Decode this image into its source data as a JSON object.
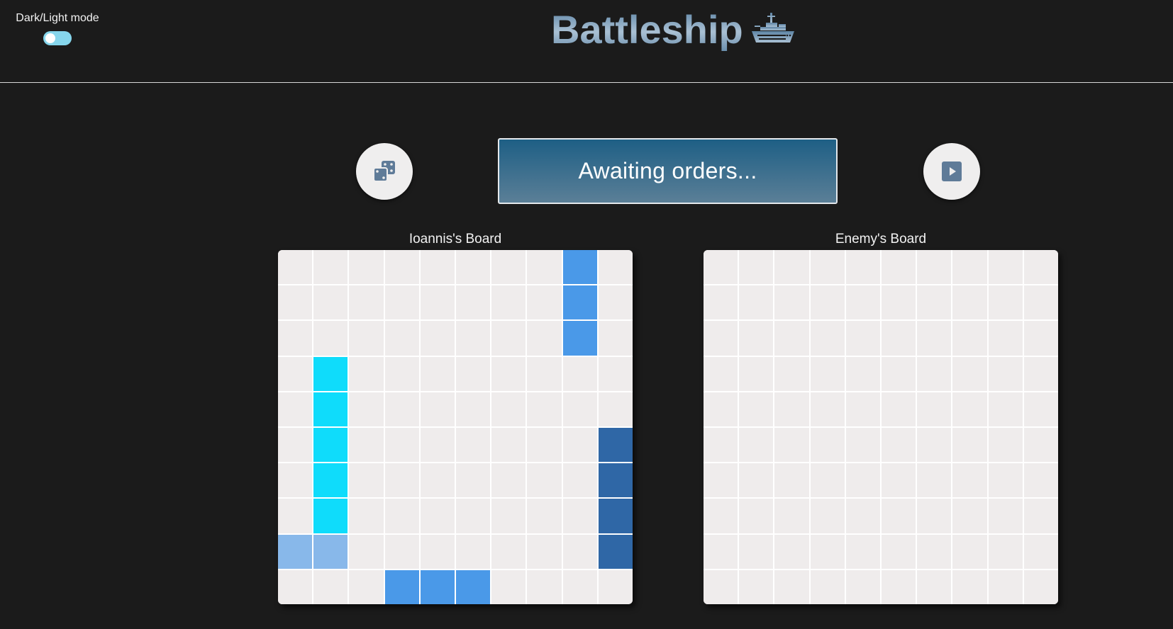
{
  "header": {
    "mode_label": "Dark/Light mode",
    "mode_toggle_on": false,
    "title": "Battleship",
    "title_icon": "battleship-icon"
  },
  "controls": {
    "randomize_icon": "dice-icon",
    "start_icon": "play-icon",
    "status_text": "Awaiting orders..."
  },
  "colors": {
    "background": "#1b1b1b",
    "cell_empty": "#efecec",
    "ship_a": "#4a99e8",
    "ship_b": "#0fdcfb",
    "ship_c": "#2f67a6",
    "ship_d": "#88b8ea",
    "status_top": "#1e5f85",
    "status_bottom": "#5b7f97",
    "toggle_track": "#86d6ec"
  },
  "player_board": {
    "title": "Ioannis's Board",
    "rows": 10,
    "cols": 10,
    "ships": [
      {
        "name": "ship-a",
        "cells": [
          [
            0,
            8
          ],
          [
            1,
            8
          ],
          [
            2,
            8
          ]
        ]
      },
      {
        "name": "ship-b",
        "cells": [
          [
            3,
            1
          ],
          [
            4,
            1
          ],
          [
            5,
            1
          ],
          [
            6,
            1
          ],
          [
            7,
            1
          ]
        ]
      },
      {
        "name": "ship-c",
        "cells": [
          [
            5,
            9
          ],
          [
            6,
            9
          ],
          [
            7,
            9
          ],
          [
            8,
            9
          ]
        ]
      },
      {
        "name": "ship-d",
        "cells": [
          [
            8,
            0
          ],
          [
            8,
            1
          ]
        ]
      },
      {
        "name": "ship-e",
        "cells": [
          [
            9,
            3
          ],
          [
            9,
            4
          ],
          [
            9,
            5
          ]
        ]
      }
    ]
  },
  "enemy_board": {
    "title": "Enemy's Board",
    "rows": 10,
    "cols": 10,
    "ships": []
  }
}
